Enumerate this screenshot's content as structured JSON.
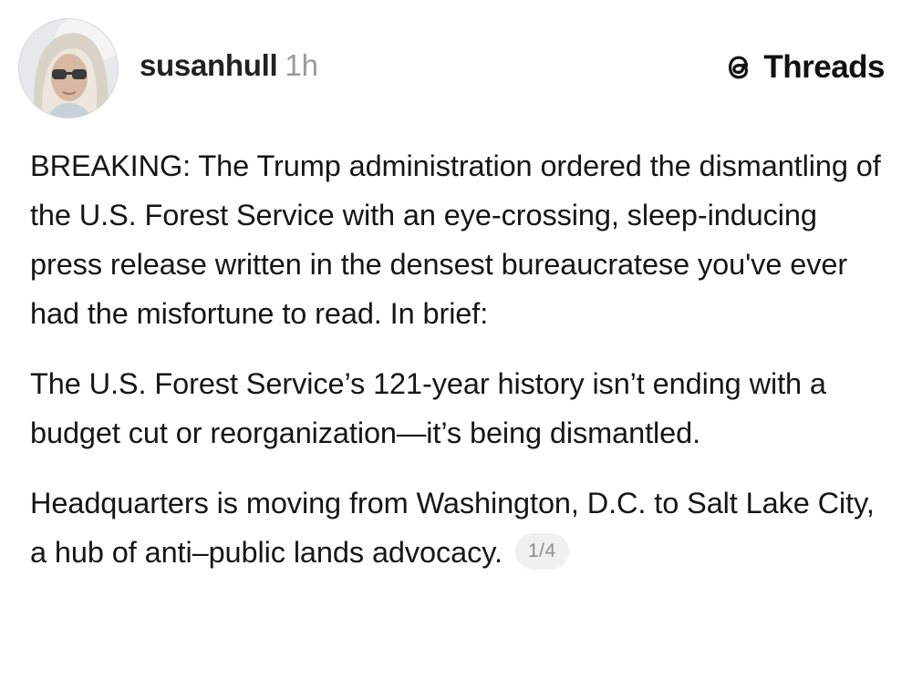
{
  "post": {
    "author": {
      "username": "susanhull",
      "timestamp": "1h",
      "avatar_icon": "profile-photo"
    },
    "platform": {
      "name": "Threads",
      "icon": "threads-logo-icon"
    },
    "paragraphs": [
      "BREAKING: The Trump administration ordered the dismantling of the U.S. Forest Service with an eye-crossing, sleep-inducing press release written in the densest bureaucratese you've ever had the misfortune to read.  In brief:",
      "The U.S. Forest Service’s 121-year history isn’t ending with a budget cut or reorganization—it’s being dismantled.",
      "Headquarters is moving from Washington, D.C. to Salt Lake City, a hub of anti–public lands advocacy."
    ],
    "page_indicator": "1/4"
  },
  "colors": {
    "background": "#ffffff",
    "text": "#161616",
    "muted": "#9a9a9a",
    "pill_bg": "#f0f0f0"
  }
}
